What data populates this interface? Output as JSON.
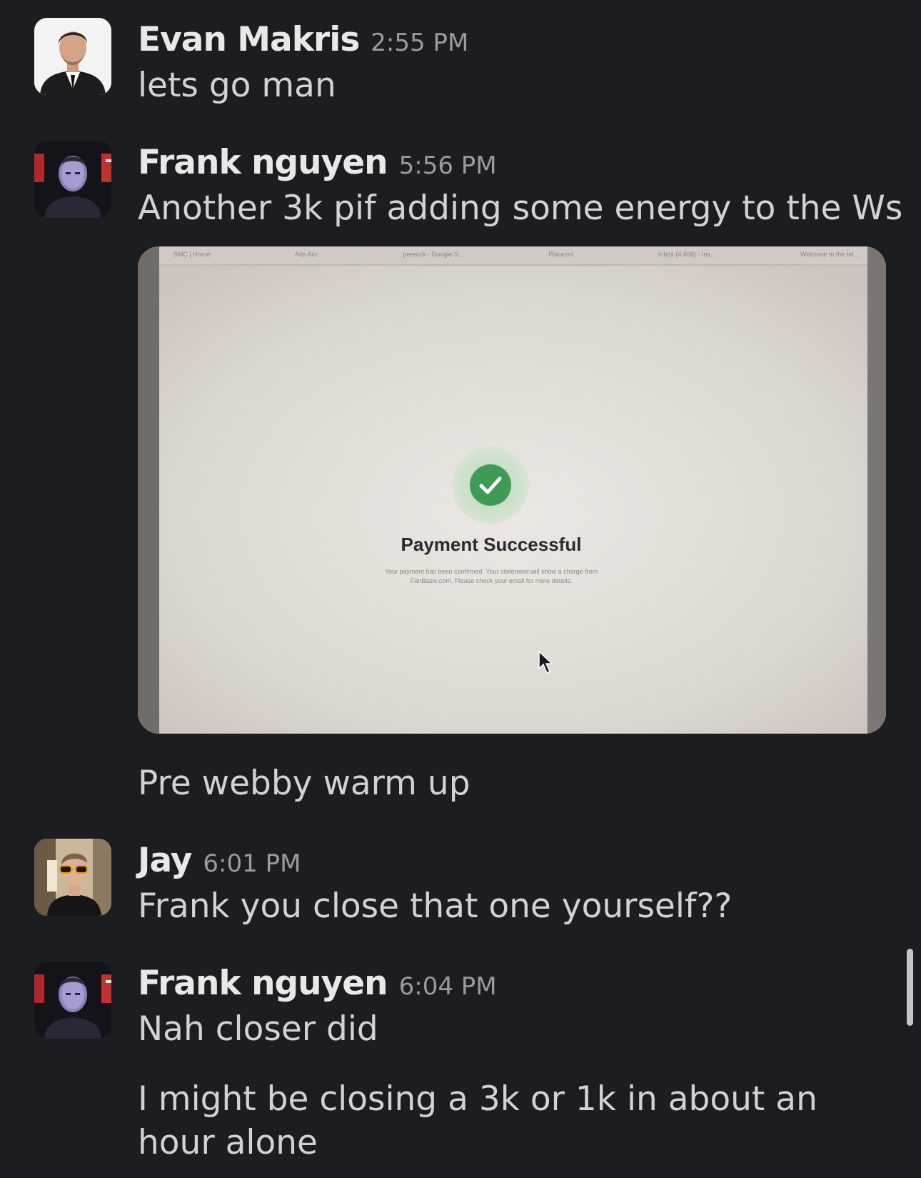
{
  "messages": [
    {
      "author": "Evan Makris",
      "time": "2:55 PM",
      "text": "lets go man"
    },
    {
      "author": "Frank nguyen",
      "time": "5:56 PM",
      "text": "Another 3k pif adding some energy to the Ws",
      "attachment": {
        "title": "Payment Successful",
        "body_line_1": "Your payment has been confirmed. Your statement will show a charge from",
        "body_line_2": "FanBasis.com. Please check your email for more details.",
        "browser_tabs": [
          "SMC | Home",
          "Ads Acc",
          "peerock - Google S...",
          "Placecrd",
          "Inbox (4,668) - Ins...",
          "Welcome to the tel..."
        ]
      },
      "followup": "Pre webby warm up"
    },
    {
      "author": "Jay",
      "time": "6:01 PM",
      "text": "Frank you close that one yourself??"
    },
    {
      "author": "Frank nguyen",
      "time": "6:04 PM",
      "text": "Nah closer did",
      "followup": "I might be closing a 3k or 1k in about an hour alone"
    }
  ]
}
